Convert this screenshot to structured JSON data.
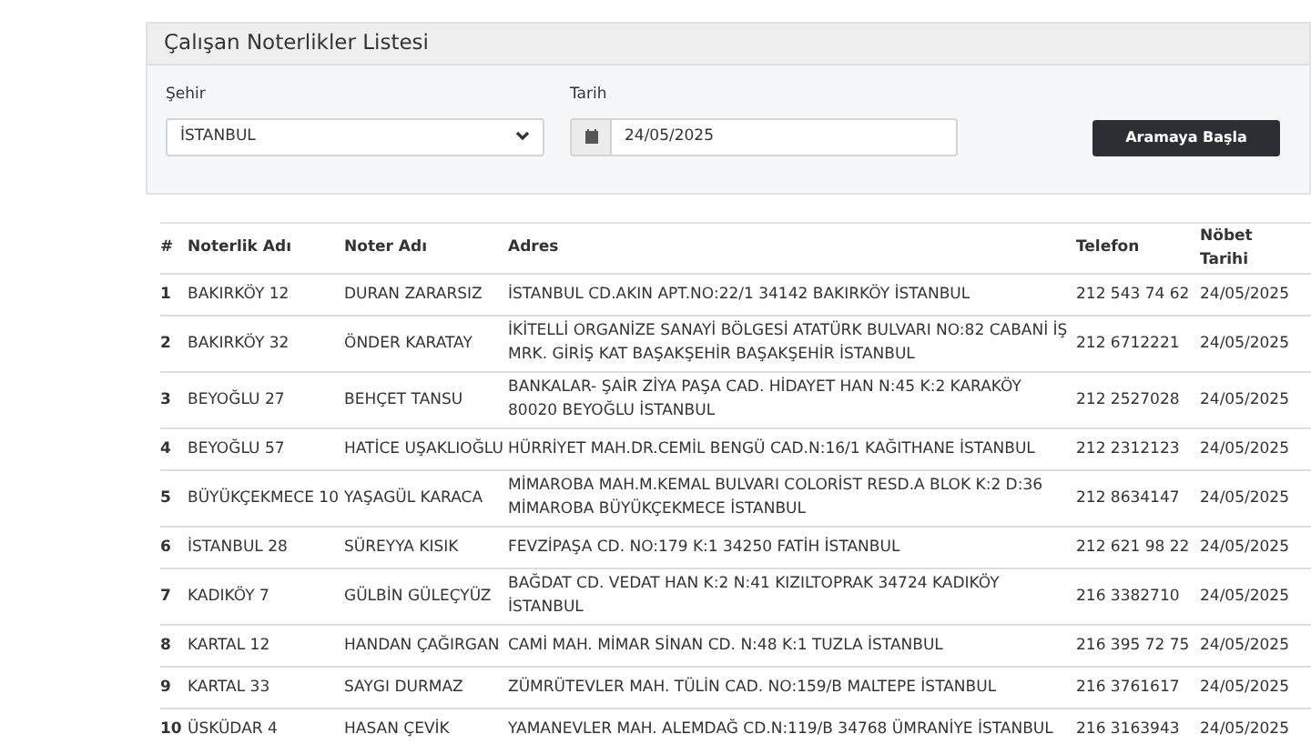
{
  "panel": {
    "title": "Çalışan Noterlikler Listesi",
    "city_label": "Şehir",
    "city_value": "İSTANBUL",
    "date_label": "Tarih",
    "date_value": "24/05/2025",
    "search_button": "Aramaya Başla"
  },
  "table": {
    "columns": [
      "#",
      "Noterlik Adı",
      "Noter Adı",
      "Adres",
      "Telefon",
      "Nöbet Tarihi"
    ],
    "rows": [
      [
        "1",
        "BAKIRKÖY 12",
        "DURAN ZARARSIZ",
        "İSTANBUL CD.AKIN APT.NO:22/1 34142 BAKIRKÖY İSTANBUL",
        "212 543 74 62",
        "24/05/2025"
      ],
      [
        "2",
        "BAKIRKÖY 32",
        "ÖNDER KARATAY",
        "İKİTELLİ ORGANİZE SANAYİ BÖLGESİ ATATÜRK BULVARI NO:82 CABANİ İŞ MRK. GİRİŞ KAT BAŞAKŞEHİR BAŞAKŞEHİR İSTANBUL",
        "212 6712221",
        "24/05/2025"
      ],
      [
        "3",
        "BEYOĞLU 27",
        "BEHÇET TANSU",
        "BANKALAR- ŞAİR ZİYA PAŞA CAD. HİDAYET HAN N:45 K:2 KARAKÖY 80020 BEYOĞLU İSTANBUL",
        "212 2527028",
        "24/05/2025"
      ],
      [
        "4",
        "BEYOĞLU 57",
        "HATİCE UŞAKLIOĞLU",
        "HÜRRİYET MAH.DR.CEMİL BENGÜ CAD.N:16/1 KAĞITHANE İSTANBUL",
        "212 2312123",
        "24/05/2025"
      ],
      [
        "5",
        "BÜYÜKÇEKMECE 10",
        "YAŞAGÜL KARACA",
        "MİMAROBA MAH.M.KEMAL BULVARI COLORİST RESD.A BLOK K:2 D:36 MİMAROBA BÜYÜKÇEKMECE İSTANBUL",
        "212 8634147",
        "24/05/2025"
      ],
      [
        "6",
        "İSTANBUL 28",
        "SÜREYYA KISIK",
        "FEVZİPAŞA CD. NO:179 K:1 34250 FATİH İSTANBUL",
        "212 621 98 22",
        "24/05/2025"
      ],
      [
        "7",
        "KADIKÖY 7",
        "GÜLBİN GÜLEÇYÜZ",
        "BAĞDAT CD. VEDAT HAN K:2 N:41 KIZILTOPRAK 34724 KADIKÖY İSTANBUL",
        "216 3382710",
        "24/05/2025"
      ],
      [
        "8",
        "KARTAL 12",
        "HANDAN ÇAĞIRGAN",
        "CAMİ MAH. MİMAR SİNAN CD. N:48 K:1 TUZLA İSTANBUL",
        "216 395 72 75",
        "24/05/2025"
      ],
      [
        "9",
        "KARTAL 33",
        "SAYGI DURMAZ",
        "ZÜMRÜTEVLER MAH. TÜLİN CAD. NO:159/B MALTEPE İSTANBUL",
        "216 3761617",
        "24/05/2025"
      ],
      [
        "10",
        "ÜSKÜDAR 4",
        "HASAN ÇEVİK",
        "YAMANEVLER MAH. ALEMDAĞ CD.N:119/B 34768 ÜMRANİYE İSTANBUL",
        "216 3163943",
        "24/05/2025"
      ]
    ]
  }
}
